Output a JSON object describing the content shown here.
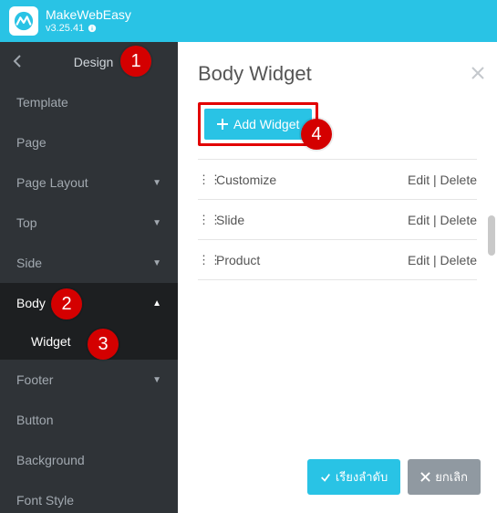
{
  "topbar": {
    "brand": "MakeWebEasy",
    "version": "v3.25.41"
  },
  "sidebar": {
    "back_title": "Design",
    "items": [
      {
        "label": "Template",
        "expandable": false
      },
      {
        "label": "Page",
        "expandable": false
      },
      {
        "label": "Page Layout",
        "expandable": true,
        "expanded": false
      },
      {
        "label": "Top",
        "expandable": true,
        "expanded": false
      },
      {
        "label": "Side",
        "expandable": true,
        "expanded": false
      },
      {
        "label": "Body",
        "expandable": true,
        "expanded": true,
        "active": true,
        "children": [
          {
            "label": "Widget"
          }
        ]
      },
      {
        "label": "Footer",
        "expandable": true,
        "expanded": false
      },
      {
        "label": "Button",
        "expandable": false
      },
      {
        "label": "Background",
        "expandable": false
      },
      {
        "label": "Font Style",
        "expandable": false
      }
    ]
  },
  "panel": {
    "title": "Body Widget",
    "add_label": "Add Widget",
    "edit_label": "Edit",
    "delete_label": "Delete",
    "separator": " | ",
    "widgets": [
      {
        "name": "Customize"
      },
      {
        "name": "Slide"
      },
      {
        "name": "Product"
      }
    ],
    "confirm_label": "เรียงลำดับ",
    "cancel_label": "ยกเลิก"
  },
  "callouts": {
    "c1": "1",
    "c2": "2",
    "c3": "3",
    "c4": "4"
  }
}
